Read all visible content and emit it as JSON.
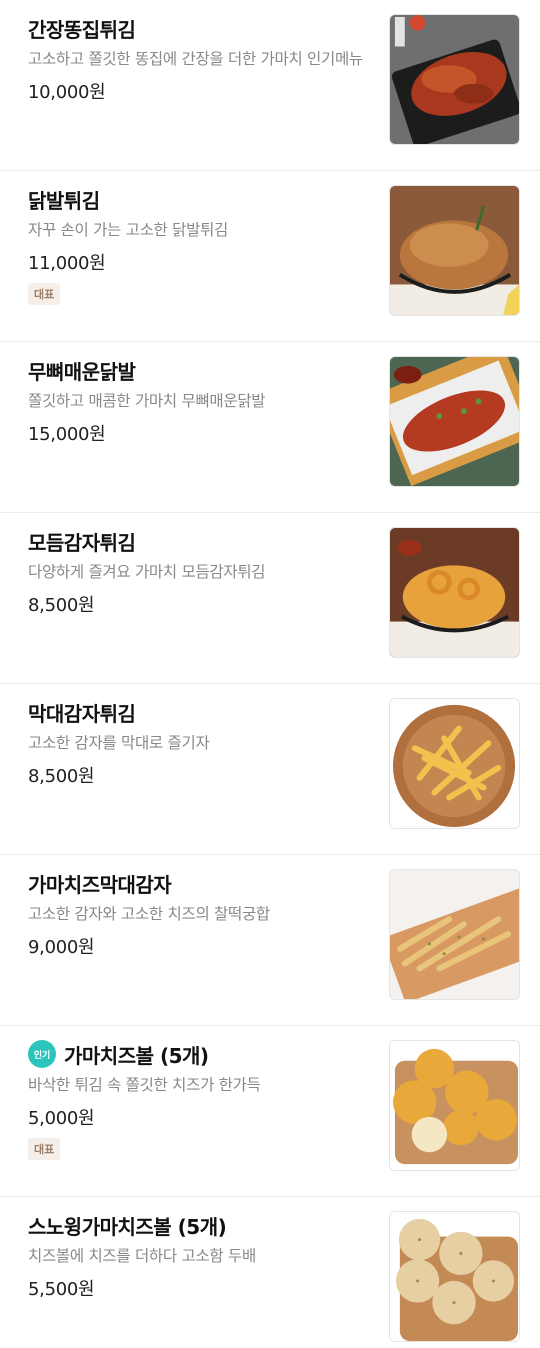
{
  "menu": {
    "items": [
      {
        "name": "간장똥집튀김",
        "desc": "고소하고 쫄깃한 똥집에 간장을 더한 가마치 인기메뉴",
        "price": "10,000원",
        "image_icon": "fried-gizzard-food-photo"
      },
      {
        "name": "닭발튀김",
        "desc": "자꾸 손이 가는 고소한 닭발튀김",
        "price": "11,000원",
        "badge": "대표",
        "image_icon": "fried-chicken-feet-food-photo"
      },
      {
        "name": "무뼈매운닭발",
        "desc": "쫄깃하고 매콤한 가마치 무뼈매운닭발",
        "price": "15,000원",
        "image_icon": "spicy-chicken-feet-food-photo"
      },
      {
        "name": "모듬감자튀김",
        "desc": "다양하게 즐겨요 가마치 모듬감자튀김",
        "price": "8,500원",
        "image_icon": "assorted-fries-food-photo"
      },
      {
        "name": "막대감자튀김",
        "desc": "고소한 감자를 막대로 즐기자",
        "price": "8,500원",
        "image_icon": "stick-fries-food-photo"
      },
      {
        "name": "가마치즈막대감자",
        "desc": "고소한 감자와 고소한 치즈의 찰떡궁합",
        "price": "9,000원",
        "image_icon": "cheese-fries-food-photo"
      },
      {
        "name": "가마치즈볼 (5개)",
        "desc": "바삭한 튀김 속 쫄깃한 치즈가 한가득",
        "price": "5,000원",
        "badge": "대표",
        "popular": "인기",
        "image_icon": "cheese-balls-food-photo"
      },
      {
        "name": "스노윙가마치즈볼 (5개)",
        "desc": "치즈볼에 치즈를 더하다 고소함 두배",
        "price": "5,500원",
        "image_icon": "snowing-cheese-balls-food-photo"
      }
    ]
  },
  "colors": {
    "popular_badge_bg": "#2cc5bd",
    "rep_badge_bg": "#f6efe9",
    "rep_badge_text": "#9a7f6b",
    "desc_text": "#888888"
  }
}
